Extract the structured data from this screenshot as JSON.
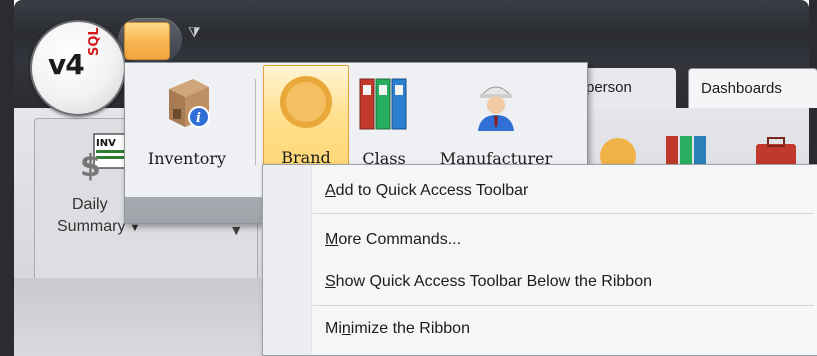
{
  "app": {
    "logo_text": "v4",
    "logo_sub": "SQL"
  },
  "tabs": [
    {
      "label": "person"
    },
    {
      "label": "Dashboards"
    }
  ],
  "ribbon": {
    "daily_label": "Daily",
    "summary_label": "Summary",
    "inv_badge": "INV"
  },
  "popup": {
    "buttons": [
      {
        "label": "Inventory",
        "icon": "inventory-box-icon"
      },
      {
        "label": "Brand",
        "icon": "brand-seal-icon"
      },
      {
        "label": "Class",
        "icon": "binders-icon"
      },
      {
        "label": "Manufacturer",
        "icon": "worker-icon"
      }
    ]
  },
  "context_menu": {
    "items": [
      {
        "pre": "",
        "key": "A",
        "post": "dd to Quick Access Toolbar"
      },
      {
        "pre": "",
        "key": "M",
        "post": "ore Commands..."
      },
      {
        "pre": "",
        "key": "S",
        "post": "how Quick Access Toolbar Below the Ribbon"
      },
      {
        "pre": "Mi",
        "key": "n",
        "post": "imize the Ribbon"
      }
    ]
  },
  "colors": {
    "accent": "#f7b34e",
    "titlebar": "#2b2d33",
    "ribbon": "#e4e6e9"
  }
}
